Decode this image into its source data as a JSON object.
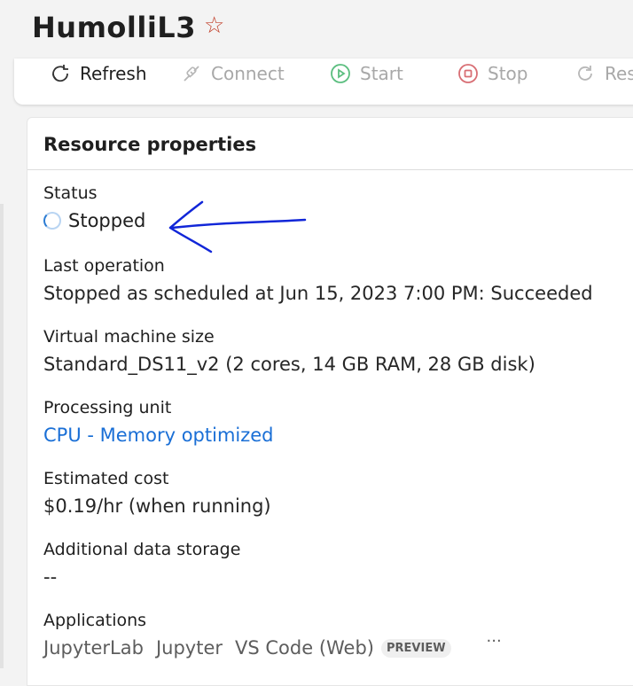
{
  "header": {
    "title": "HumolliL3",
    "favorite_icon": "star-icon"
  },
  "toolbar": {
    "refresh": "Refresh",
    "connect": "Connect",
    "start": "Start",
    "stop": "Stop",
    "restart": "Res"
  },
  "card": {
    "title": "Resource properties",
    "status": {
      "label": "Status",
      "value": "Stopped"
    },
    "last_operation": {
      "label": "Last operation",
      "value": "Stopped as scheduled at Jun 15, 2023 7:00 PM: Succeeded"
    },
    "vm_size": {
      "label": "Virtual machine size",
      "value": "Standard_DS11_v2 (2 cores, 14 GB RAM, 28 GB disk)"
    },
    "processing_unit": {
      "label": "Processing unit",
      "value": "CPU - Memory optimized"
    },
    "estimated_cost": {
      "label": "Estimated cost",
      "value": "$0.19/hr (when running)"
    },
    "additional_storage": {
      "label": "Additional data storage",
      "value": "--"
    },
    "applications": {
      "label": "Applications",
      "items": [
        "JupyterLab",
        "Jupyter",
        "VS Code (Web)"
      ],
      "badge": "PREVIEW",
      "more": "···"
    }
  },
  "colors": {
    "link": "#1a6fd6",
    "star": "#c2412b",
    "start_icon": "#17a34a",
    "stop_icon": "#c8323a",
    "annotation": "#1126d8"
  }
}
